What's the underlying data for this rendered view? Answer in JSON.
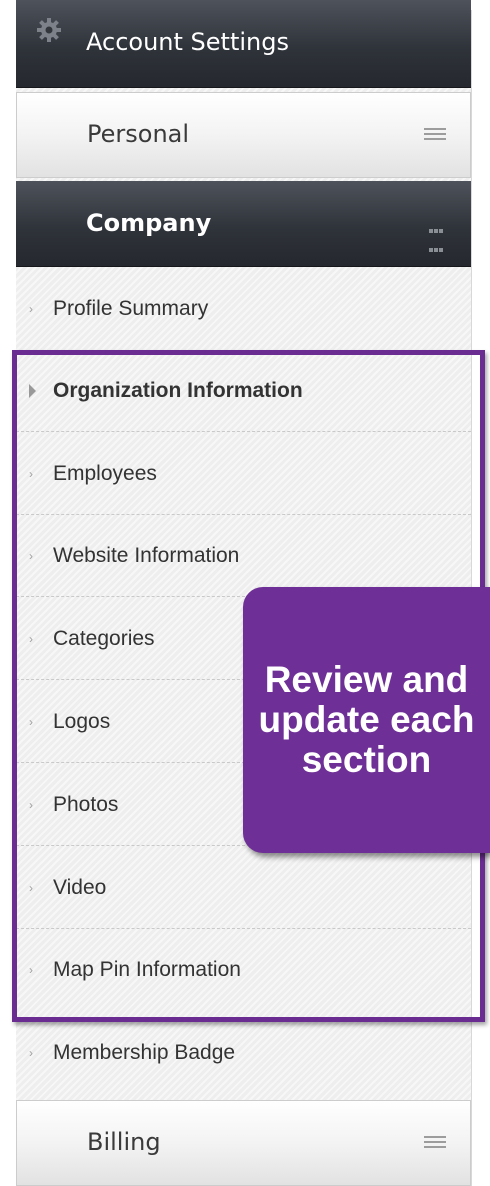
{
  "header": {
    "title": "Account Settings",
    "icon": "gear-icon"
  },
  "sections": {
    "personal": {
      "label": "Personal",
      "icon": "menu-lines-icon"
    },
    "company": {
      "label": "Company",
      "icon": "grid-icon"
    },
    "billing": {
      "label": "Billing",
      "icon": "menu-lines-icon"
    }
  },
  "company_items": [
    {
      "label": "Profile Summary",
      "active": false
    },
    {
      "label": "Organization Information",
      "active": true
    },
    {
      "label": "Employees",
      "active": false
    },
    {
      "label": "Website Information",
      "active": false
    },
    {
      "label": "Categories",
      "active": false
    },
    {
      "label": "Logos",
      "active": false
    },
    {
      "label": "Photos",
      "active": false
    },
    {
      "label": "Video",
      "active": false
    },
    {
      "label": "Map Pin Information",
      "active": false
    },
    {
      "label": "Membership Badge",
      "active": false
    }
  ],
  "callout": {
    "text": "Review and update each section"
  },
  "colors": {
    "accent": "#6a2c91",
    "header_dark": "#2f333a"
  }
}
